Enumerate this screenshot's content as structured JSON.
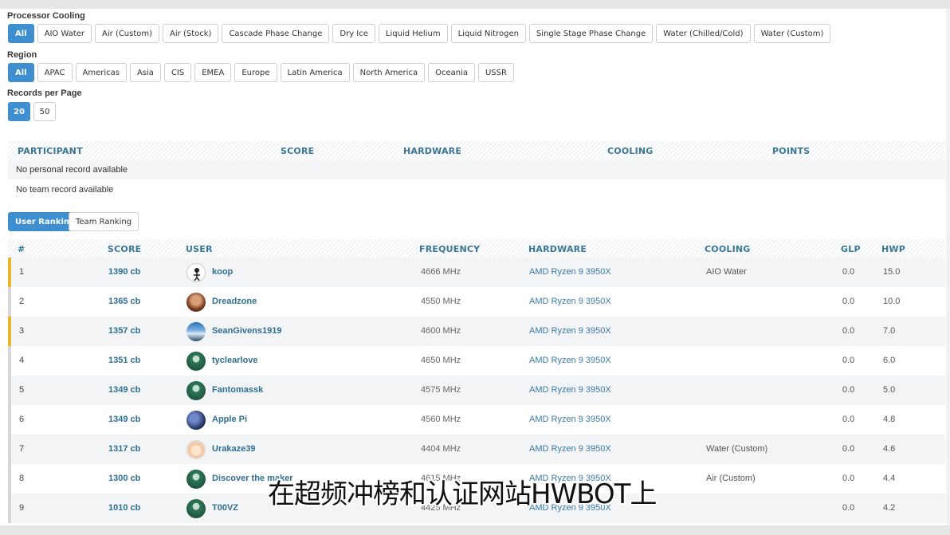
{
  "filters": {
    "processor_cooling": {
      "title": "Processor Cooling",
      "options": [
        "All",
        "AIO Water",
        "Air (Custom)",
        "Air (Stock)",
        "Cascade Phase Change",
        "Dry Ice",
        "Liquid Helium",
        "Liquid Nitrogen",
        "Single Stage Phase Change",
        "Water (Chilled/Cold)",
        "Water (Custom)"
      ],
      "selected": "All"
    },
    "region": {
      "title": "Region",
      "options": [
        "All",
        "APAC",
        "Americas",
        "Asia",
        "CIS",
        "EMEA",
        "Europe",
        "Latin America",
        "North America",
        "Oceania",
        "USSR"
      ],
      "selected": "All"
    },
    "records_per_page": {
      "title": "Records per Page",
      "options": [
        "20",
        "50"
      ],
      "selected": "20"
    }
  },
  "personal": {
    "headers": [
      "PARTICIPANT",
      "SCORE",
      "HARDWARE",
      "COOLING",
      "POINTS"
    ],
    "personal_msg": "No personal record available",
    "team_msg": "No team record available"
  },
  "tabs": [
    "User Ranking",
    "Team Ranking"
  ],
  "active_tab": "User Ranking",
  "ranking": {
    "headers": [
      "#",
      "SCORE",
      "USER",
      "FREQUENCY",
      "HARDWARE",
      "COOLING",
      "GLP",
      "HWP"
    ],
    "rows": [
      {
        "rank": "1",
        "score": "1390 cb",
        "user": "koop",
        "freq": "4666 MHz",
        "hw": "AMD Ryzen 9 3950X",
        "cool": "AIO Water",
        "glp": "0.0",
        "hwp": "15.0"
      },
      {
        "rank": "2",
        "score": "1365 cb",
        "user": "Dreadzone",
        "freq": "4550 MHz",
        "hw": "AMD Ryzen 9 3950X",
        "cool": "",
        "glp": "0.0",
        "hwp": "10.0"
      },
      {
        "rank": "3",
        "score": "1357 cb",
        "user": "SeanGivens1919",
        "freq": "4600 MHz",
        "hw": "AMD Ryzen 9 3950X",
        "cool": "",
        "glp": "0.0",
        "hwp": "7.0"
      },
      {
        "rank": "4",
        "score": "1351 cb",
        "user": "tyclearlove",
        "freq": "4650 MHz",
        "hw": "AMD Ryzen 9 3950X",
        "cool": "",
        "glp": "0.0",
        "hwp": "6.0"
      },
      {
        "rank": "5",
        "score": "1349 cb",
        "user": "Fantomassk",
        "freq": "4575 MHz",
        "hw": "AMD Ryzen 9 3950X",
        "cool": "",
        "glp": "0.0",
        "hwp": "5.0"
      },
      {
        "rank": "6",
        "score": "1349 cb",
        "user": "Apple Pi",
        "freq": "4560 MHz",
        "hw": "AMD Ryzen 9 3950X",
        "cool": "",
        "glp": "0.0",
        "hwp": "4.8"
      },
      {
        "rank": "7",
        "score": "1317 cb",
        "user": "Urakaze39",
        "freq": "4404 MHz",
        "hw": "AMD Ryzen 9 3950X",
        "cool": "Water (Custom)",
        "glp": "0.0",
        "hwp": "4.6"
      },
      {
        "rank": "8",
        "score": "1300 cb",
        "user": "Discover the maker",
        "freq": "4615 MHz",
        "hw": "AMD Ryzen 9 3950X",
        "cool": "Air (Custom)",
        "glp": "0.0",
        "hwp": "4.4"
      },
      {
        "rank": "9",
        "score": "1010 cb",
        "user": "T00VZ",
        "freq": "4425 MHz",
        "hw": "AMD Ryzen 9 3950X",
        "cool": "",
        "glp": "0.0",
        "hwp": "4.2"
      }
    ]
  },
  "subtitle": "在超频冲榜和认证网站HWBOT上",
  "colors": {
    "accent": "#3e8ed0",
    "link": "#2f6f91",
    "gold": "#e8b52d"
  }
}
